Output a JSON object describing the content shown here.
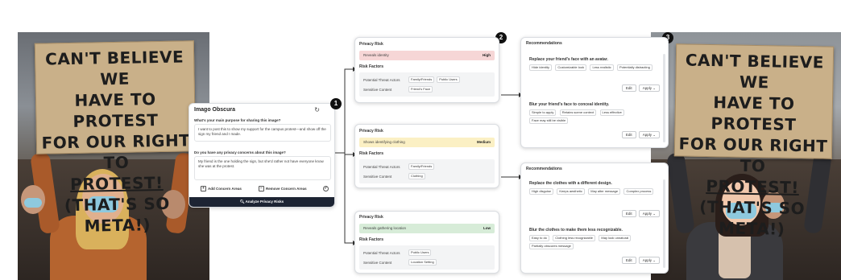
{
  "colors": {
    "high": "#f6d6d6",
    "medium": "#fbf0c4",
    "low": "#d7ecd8",
    "analyze_bg": "#1d2433",
    "sign": "#c9b089"
  },
  "sign_lines": [
    "CAN'T BELIEVE WE",
    "HAVE TO PROTEST",
    "FOR OUR RIGHT TO",
    "PROTEST!",
    "(THAT'S SO META!)"
  ],
  "badges": [
    "1",
    "2",
    "3"
  ],
  "imago": {
    "title": "Imago Obscura",
    "refresh_icon": "refresh-icon",
    "q1": "What's your main purpose for sharing this image?",
    "a1": "I want to post this to show my support for the campus protest—and show off the sign my friend and I made.",
    "q2": "Do you have any privacy concerns about this image?",
    "a2": "My friend is the one holding the sign, but she'd rather not have everyone know she was at the protest.",
    "add_label": "Add Concern Areas",
    "remove_label": "Remove Concern Areas",
    "analyze_label": "Analyze Privacy Risks"
  },
  "risks": [
    {
      "title": "Privacy Risk",
      "risk": "Reveals identity",
      "level": "High",
      "factors_title": "Risk Factors",
      "factors": [
        {
          "label": "Potential Threat Actors",
          "chips": [
            "Family/Friends",
            "Public Users"
          ]
        },
        {
          "label": "Sensitive Content",
          "chips": [
            "Friend's Face"
          ]
        }
      ]
    },
    {
      "title": "Privacy Risk",
      "risk": "Shows identifying clothing",
      "level": "Medium",
      "factors_title": "Risk Factors",
      "factors": [
        {
          "label": "Potential Threat Actors",
          "chips": [
            "Family/Friends"
          ]
        },
        {
          "label": "Sensitive Content",
          "chips": [
            "Clothing"
          ]
        }
      ]
    },
    {
      "title": "Privacy Risk",
      "risk": "Reveals gathering location",
      "level": "Low",
      "factors_title": "Risk Factors",
      "factors": [
        {
          "label": "Potential Threat Actors",
          "chips": [
            "Public Users"
          ]
        },
        {
          "label": "Sensitive Content",
          "chips": [
            "Location Setting"
          ]
        }
      ]
    }
  ],
  "recs": [
    {
      "title": "Recommendations",
      "items": [
        {
          "heading": "Replace your friend's face with an avatar.",
          "chips": [
            "Hide identity",
            "Customizable look",
            "Less realistic",
            "Potentially distracting"
          ],
          "edit": "Edit",
          "apply": "Apply"
        },
        {
          "heading": "Blur your friend's face to conceal identity.",
          "chips": [
            "Simple to apply",
            "Retains scene context",
            "Less effective",
            "Face may still be visible"
          ],
          "edit": "Edit",
          "apply": "Apply"
        }
      ]
    },
    {
      "title": "Recommendations",
      "items": [
        {
          "heading": "Replace the clothes with a different design.",
          "chips": [
            "High disguise",
            "Keeps aesthetic",
            "May alter message",
            "Complex process"
          ],
          "edit": "Edit",
          "apply": "Apply"
        },
        {
          "heading": "Blur the clothes to make them less recognizable.",
          "chips": [
            "Easy to do",
            "Clothing less recognizable",
            "May look unnatural",
            "Partially obscures message"
          ],
          "edit": "Edit",
          "apply": "Apply"
        }
      ]
    }
  ]
}
